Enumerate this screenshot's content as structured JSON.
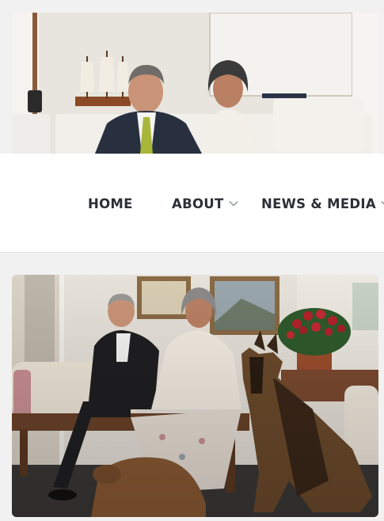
{
  "header_photo": {
    "alt_icon": "couple-photo",
    "colors": {
      "wall": "#e7e3dd",
      "suit": "#283040",
      "tie": "#a8b63a",
      "blouse": "#f3efe9"
    }
  },
  "nav": {
    "items": [
      {
        "label": "HOME",
        "has_dropdown": false
      },
      {
        "label": "ABOUT",
        "has_dropdown": true
      },
      {
        "label": "NEWS & MEDIA",
        "has_dropdown": true
      }
    ],
    "text_color": "#2c2f36",
    "chevron_color": "#9aa0a6"
  },
  "feature_photo": {
    "alt_icon": "couple-with-dogs-photo",
    "colors": {
      "floor": "#3a3a3a",
      "flowers": "#b3222b",
      "dog": "#6b4a2b"
    }
  }
}
